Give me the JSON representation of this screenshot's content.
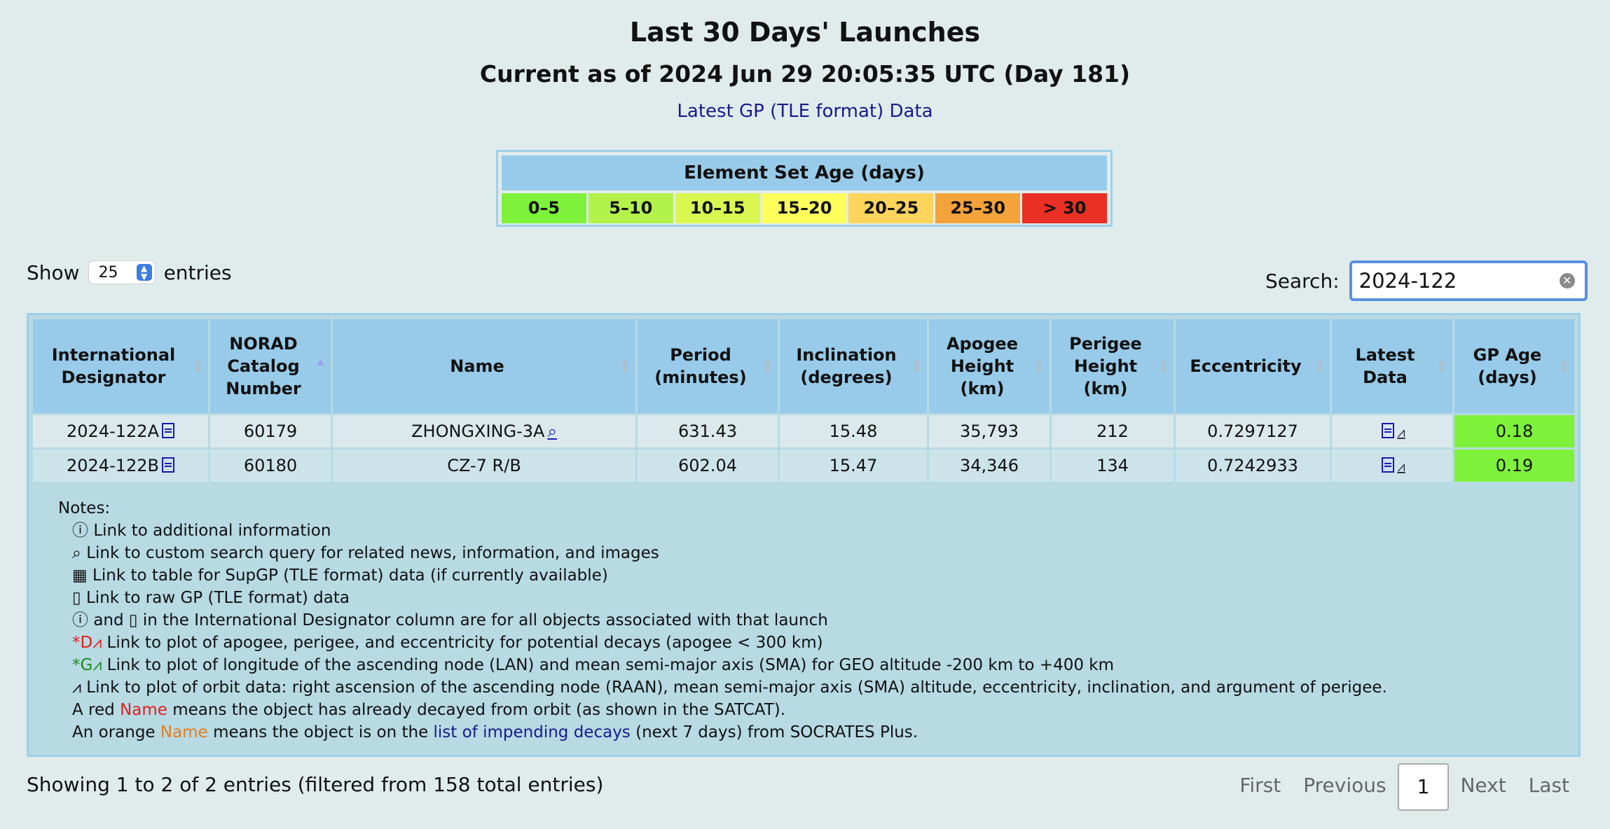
{
  "page": {
    "title": "Last 30 Days' Launches",
    "subtitle": "Current as of 2024 Jun 29 20:05:35 UTC (Day 181)",
    "data_link": "Latest GP (TLE format) Data"
  },
  "legend": {
    "title": "Element Set Age (days)",
    "cells": [
      {
        "label": "0–5",
        "color": "#7ef23a"
      },
      {
        "label": "5–10",
        "color": "#b3f24a"
      },
      {
        "label": "10–15",
        "color": "#d9f750"
      },
      {
        "label": "15–20",
        "color": "#ffff5c"
      },
      {
        "label": "20–25",
        "color": "#ffd45c"
      },
      {
        "label": "25–30",
        "color": "#f3a33a"
      },
      {
        "label": "> 30",
        "color": "#ea2f24"
      }
    ]
  },
  "controls": {
    "show_label": "Show",
    "entries_value": "25",
    "entries_label": "entries",
    "search_label": "Search:",
    "search_value": "2024-122"
  },
  "table": {
    "headers": [
      "International Designator",
      "NORAD Catalog Number",
      "Name",
      "Period (minutes)",
      "Inclination (degrees)",
      "Apogee Height (km)",
      "Perigee Height (km)",
      "Eccentricity",
      "Latest Data",
      "GP Age (days)"
    ],
    "rows": [
      {
        "designator": "2024-122A",
        "norad": "60179",
        "name": "ZHONGXING-3A",
        "period": "631.43",
        "inclination": "15.48",
        "apogee": "35,793",
        "perigee": "212",
        "eccentricity": "0.7297127",
        "age": "0.18"
      },
      {
        "designator": "2024-122B",
        "norad": "60180",
        "name": "CZ-7 R/B",
        "period": "602.04",
        "inclination": "15.47",
        "apogee": "34,346",
        "perigee": "134",
        "eccentricity": "0.7242933",
        "age": "0.19"
      }
    ]
  },
  "notes": {
    "title": "Notes:",
    "n1": "Link to additional information",
    "n2": "Link to custom search query for related news, information, and images",
    "n3": "Link to table for SupGP (TLE format) data (if currently available)",
    "n4": "Link to raw GP (TLE format) data",
    "n5a": "and",
    "n5b": "in the International Designator column are for all objects associated with that launch",
    "n6a": "*D",
    "n6b": "Link to plot of apogee, perigee, and eccentricity for potential decays (apogee < 300 km)",
    "n7a": "*G",
    "n7b": "Link to plot of longitude of the ascending node (LAN) and mean semi-major axis (SMA) for GEO altitude -200 km to +400 km",
    "n8": "Link to plot of orbit data: right ascension of the ascending node (RAAN), mean semi-major axis (SMA) altitude, eccentricity, inclination, and argument of perigee.",
    "n9a": "A red",
    "n9b": "Name",
    "n9c": "means the object has already decayed from orbit (as shown in the SATCAT).",
    "n10a": "An orange",
    "n10b": "Name",
    "n10c": "means the object is on the",
    "n10d": "list of impending decays",
    "n10e": "(next 7 days) from SOCRATES Plus."
  },
  "footer": {
    "info": "Showing 1 to 2 of 2 entries (filtered from 158 total entries)",
    "first": "First",
    "previous": "Previous",
    "page": "1",
    "next": "Next",
    "last": "Last"
  }
}
